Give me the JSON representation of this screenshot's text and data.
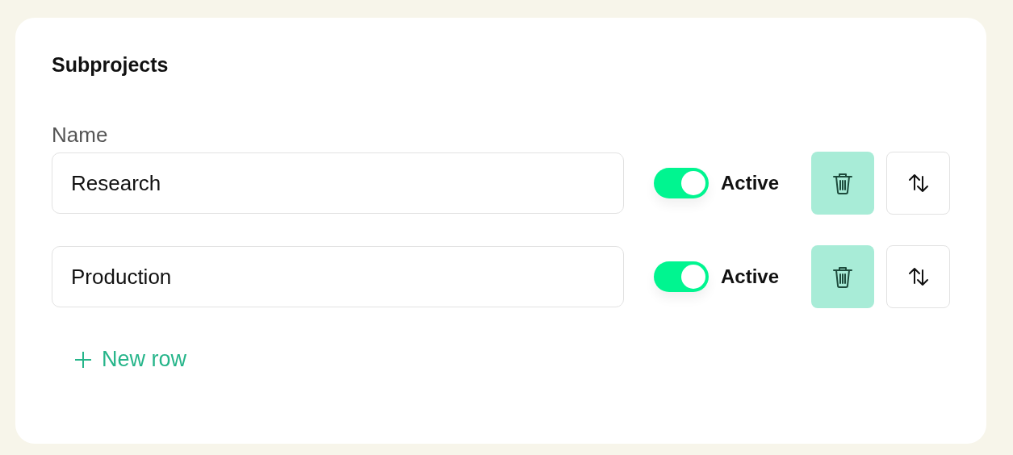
{
  "title": "Subprojects",
  "name_label": "Name",
  "rows": [
    {
      "name": "Research",
      "active": true,
      "status_label": "Active"
    },
    {
      "name": "Production",
      "active": true,
      "status_label": "Active"
    }
  ],
  "add_button": "New row"
}
